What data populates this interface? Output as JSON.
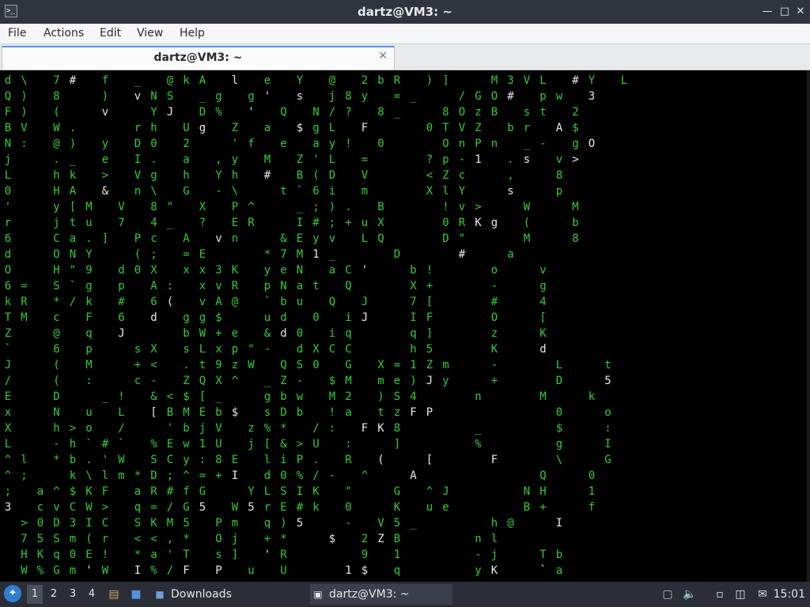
{
  "window": {
    "title": "dartz@VM3: ~",
    "app_icon_glyph": ">_",
    "minimize_glyph": "—",
    "maximize_glyph": "□",
    "close_glyph": "✕"
  },
  "menubar": {
    "items": [
      "File",
      "Actions",
      "Edit",
      "View",
      "Help"
    ]
  },
  "tabs": [
    {
      "label": "dartz@VM3: ~",
      "close_glyph": "✕"
    }
  ],
  "terminal": {
    "colors": {
      "background": "#000000",
      "green": "#33cc33",
      "white": "#e8e8e8"
    },
    "columns": [
      {
        "col": 0,
        "top_row": 0,
        "chars": "dQFBNjL0'r6dO6kTZ`J/ExXL^^",
        "head": "T"
      },
      {
        "col": 1,
        "top_row": 0,
        "chars": "\\))V:",
        "head": ":"
      },
      {
        "col": 1,
        "top_row": 13,
        "chars": "=RMZ`J/ExXL^^",
        "head": "^"
      },
      {
        "col": 2,
        "top_row": 24,
        "chars": "l;;3",
        "head": "3"
      },
      {
        "col": 3,
        "top_row": 0,
        "chars": "7 (W@.hHyjCOHS*c@6((",
        "head": "("
      },
      {
        "col": 4,
        "top_row": 0,
        "chars": "#8(.)_k A[tuNYg`/kFqpM:Duh-*zac05K%",
        "head": "/"
      },
      {
        "col": 5,
        "top_row": 0,
        "chars": "f",
        "head": "f"
      },
      {
        "col": 5,
        "top_row": 8,
        "chars": "yMua.Y9gkFqpM:Duh-*zac05K%G",
        "head": "S"
      },
      {
        "col": 6,
        "top_row": 0,
        "chars": "_)v",
        "head": "v"
      },
      {
        "col": 6,
        "top_row": 4,
        "chars": "ye>&V7]",
        "head": "]"
      },
      {
        "col": 6,
        "top_row": 12,
        "chars": "dp#6J",
        "head": "J"
      },
      {
        "col": 7,
        "top_row": 0,
        "chars": "@vYrDIVn84P(0A6d",
        "head": "d"
      },
      {
        "col": 8,
        "top_row": 0,
        "chars": "kN",
        "head": "N"
      },
      {
        "col": 9,
        "top_row": 0,
        "chars": "ASJh0.g\\\"_c;X:(",
        "head": "("
      },
      {
        "col": 10,
        "top_row": 13,
        "chars": "hdvSX<&[/`SDaqS<*I%",
        "head": "%"
      },
      {
        "col": 11,
        "top_row": 0,
        "chars": "l_DU2ahGX?A",
        "head": "A"
      },
      {
        "col": 12,
        "top_row": 0,
        "chars": "eg%g",
        "head": "g"
      },
      {
        "col": 13,
        "top_row": 4,
        "chars": "',Y-PEv=xxvgbsLtQ<$EbwMQ5E\"L",
        "head": "<"
      },
      {
        "col": 14,
        "top_row": 0,
        "chars": "Yg'Zfyh\\^RnE3-AgWLX9z^[bj18+f5*T",
        "head": "E"
      },
      {
        "col": 15,
        "top_row": 0,
        "chars": "@sQaeM#",
        "head": "#"
      },
      {
        "col": 15,
        "top_row": 12,
        "chars": "KR@$ep W_=$VUEI",
        "head": "["
      },
      {
        "col": 16,
        "top_row": 17,
        "chars": "-Q_gzjldY5m]|u|",
        "head": "g"
      },
      {
        "col": 17,
        "top_row": 17,
        "chars": "SZ-bwDb%iP0SIEq)*+",
        "head": "r"
      },
      {
        "col": 18,
        "top_row": 17,
        "chars": "0<b*/&P%/I#q*'",
        "head": "<"
      },
      {
        "col": 19,
        "top_row": 0,
        "chars": "2jN$ayZB`;I#*yp`",
        "head": "&"
      },
      {
        "col": 19,
        "top_row": 17,
        "chars": "X$M2!a:>/.-Kkk5",
        "head": "5"
      },
      {
        "col": 20,
        "top_row": 0,
        "chars": "bR8y/?gL!ydeN$Ymx3>e(c;a1^mnKFt8l:[AK",
        "head": "$"
      },
      {
        "col": 21,
        "top_row": 0,
        "chars": ")]=8F0LxVmBxQk'JJqcmy4P",
        "head": "P"
      },
      {
        "col": 22,
        "top_row": 0,
        "chars": "_",
        "head": "_"
      },
      {
        "col": 23,
        "top_row": 0,
        "chars": "M/8O0?<X!0RD7bX7Ih",
        "head": "5"
      },
      {
        "col": 24,
        "top_row": 0,
        "chars": "3GOTnpZlvRK\"!+[FJ",
        "head": "g"
      },
      {
        "col": 25,
        "top_row": 0,
        "chars": "VOVZn1",
        "head": "1"
      },
      {
        "col": 26,
        "top_row": 0,
        "chars": "L#BZn",
        "head": "1"
      },
      {
        "col": 27,
        "top_row": 0,
        "chars": "#ps_,sW(M#o#OzKLDM0$g\\QNBHhn-y",
        "head": "K"
      },
      {
        "col": 28,
        "top_row": 0,
        "chars": "Yw-rs",
        "head": "s"
      },
      {
        "col": 29,
        "top_row": 0,
        "chars": "L32$O",
        "head": "O"
      },
      {
        "col": 30,
        "top_row": 0,
        "chars": "HlpH%xJJ*r0G7YuI\"a?i",
        "head": "I"
      }
    ],
    "grid": [
      "d\\ 7# f _ @kA l e Y @ 2bR )]  M3VL #Y L",
      "Q) 8  ) vNS _g g' s j8y =_  /GO# pw 3",
      "F) (  v  YJ D% ' Q N/? 8_  8OzB st 2",
      "BV W.   rh Ug Z a $gL F   0TVZ br A$",
      "N: @) y D0 2  'f e ay! 0   OnPn _- gO",
      "j  ._ e I. a ,y M Z'L =   ?p-1 .s v>",
      "L  hk > Vg h Yh # B(D V   <Zc  ,  8",
      "0  HA & n\\ G -\\  t`6i m   XlY  s  p",
      "'  y[M V 8\" X P^  _;). B   !v>  W  M",
      "r  jtu 7 4_ ? ER  I#;+uX   0RKg (  b",
      "6  Ca.] Pc A vn  &Eyv LQ   D\"   M  8",
      "d  ONY  (; =E   *7M1_   D   #  a",
      "O  H\"9 d0X xx3K yeN aC'  b!   o  v",
      "6= S`g p A: xvR pNat Q   X+   -  g",
      "kR */k # 6( vA@ `bu Q J  7[   #  4",
      "TM c F 6 d gg$  ud 0 iJ  IF   O  [",
      "Z  @ q J   bW+e &d0 iq   q]   z  K",
      "`  6 p  sX sLxp\"- dXCC   h5   K  d",
      "J  ( M  +< .t9zW QS0 G X=1Zm  -   L  t",
      "/  ( :  c- ZQX^ _Z- $M me)Jy  +   D  5",
      "E  D  _! &<$[_  gbw M2 )S4   n   M  k",
      "x  N u L [BMEb$ sDb !a tzFP       0  o",
      "X  h>o /  'bjV z%* /: FK8    _    $  :",
      "L  -h`#` %Ew1U j[&>U :  ]    %    g  I",
      "^l *b.'W SCy:8E liP. R (  [   F   \\  G",
      "^;  k\\lm*D;^=+I d0%/- ^  A       Q  0",
      "; a^$KF aR#fG  YLSIK \"  G ^J    NH  1",
      "3 cvCW> q=/G5 W5rE#k 0  K ue    B+  f",
      " >0D3IC SKM5 Pm q)5  - V5_    h@  I",
      " 75Sm(r <<,* Oj +*  $ 2ZB    nl",
      " HKq0E! *a'T s] 'R    9 1    -j  Tb",
      " W%Gm'W I%/F P u U   1$ q    yK  `a"
    ]
  },
  "taskbar": {
    "start_glyph": "✦",
    "workspaces": [
      "1",
      "2",
      "3",
      "4"
    ],
    "active_workspace": "1",
    "tasks": [
      {
        "label": "Downloads",
        "icon": "folder-icon"
      },
      {
        "label": "dartz@VM3: ~",
        "icon": "terminal-icon"
      }
    ],
    "clock": "15:01"
  }
}
